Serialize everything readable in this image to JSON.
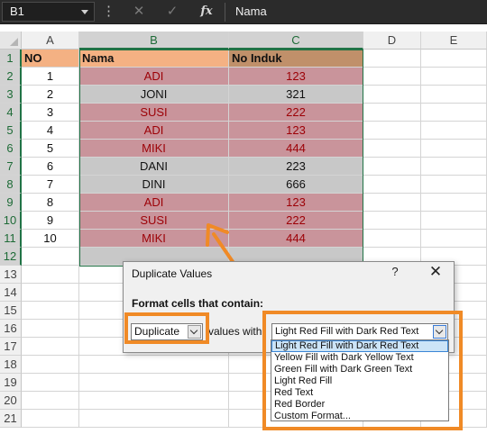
{
  "formula_bar": {
    "name_box": "B1",
    "fx_label": "fx",
    "value": "Nama"
  },
  "columns": [
    "A",
    "B",
    "C",
    "D",
    "E"
  ],
  "rows": [
    "1",
    "2",
    "3",
    "4",
    "5",
    "6",
    "7",
    "8",
    "9",
    "10",
    "11",
    "12",
    "13",
    "14",
    "15",
    "16",
    "17",
    "18",
    "19",
    "20",
    "21"
  ],
  "table": {
    "headers": [
      "NO",
      "Nama",
      "No Induk"
    ],
    "rows": [
      {
        "no": "1",
        "nama": "ADI",
        "induk": "123",
        "dup": true
      },
      {
        "no": "2",
        "nama": "JONI",
        "induk": "321",
        "dup": false
      },
      {
        "no": "3",
        "nama": "SUSI",
        "induk": "222",
        "dup": true
      },
      {
        "no": "4",
        "nama": "ADI",
        "induk": "123",
        "dup": true
      },
      {
        "no": "5",
        "nama": "MIKI",
        "induk": "444",
        "dup": true
      },
      {
        "no": "6",
        "nama": "DANI",
        "induk": "223",
        "dup": false
      },
      {
        "no": "7",
        "nama": "DINI",
        "induk": "666",
        "dup": false
      },
      {
        "no": "8",
        "nama": "ADI",
        "induk": "123",
        "dup": true
      },
      {
        "no": "9",
        "nama": "SUSI",
        "induk": "222",
        "dup": true
      },
      {
        "no": "10",
        "nama": "MIKI",
        "induk": "444",
        "dup": true
      }
    ]
  },
  "colors": {
    "header_a_b": "#f4b183",
    "header_c": "#c0906a",
    "dup_fill": "#c9949b",
    "dup_text": "#9c0006",
    "plain_fill": "#c8c8c8",
    "highlight": "#f08a26"
  },
  "dialog": {
    "title": "Duplicate Values",
    "help": "?",
    "close": "✕",
    "prompt": "Format cells that contain:",
    "type_value": "Duplicate",
    "values_with": "values with",
    "format_value": "Light Red Fill with Dark Red Text",
    "options": [
      "Light Red Fill with Dark Red Text",
      "Yellow Fill with Dark Yellow Text",
      "Green Fill with Dark Green Text",
      "Light Red Fill",
      "Red Text",
      "Red Border",
      "Custom Format..."
    ]
  }
}
